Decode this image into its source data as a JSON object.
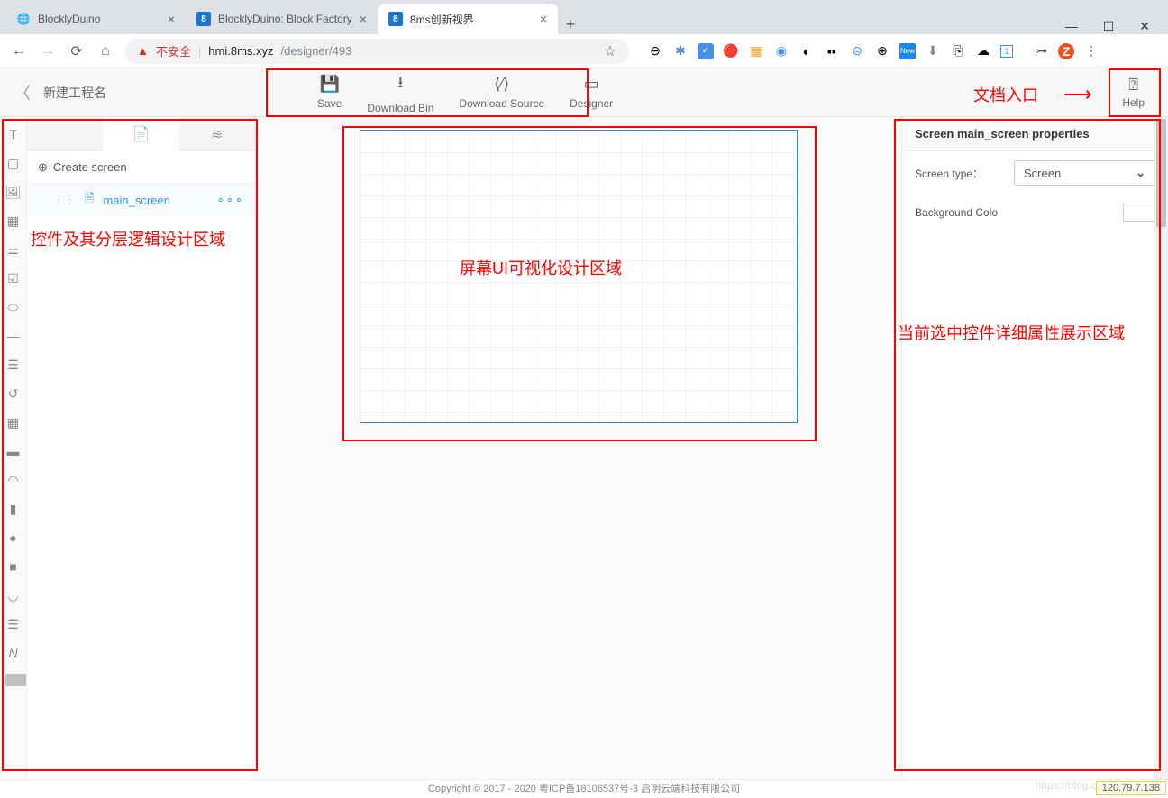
{
  "window": {
    "minimize": "—",
    "maximize": "☐",
    "close": "✕"
  },
  "tabs": [
    {
      "title": "BlocklyDuino",
      "icon": "◌"
    },
    {
      "title": "BlocklyDuino: Block Factory",
      "icon": "8"
    },
    {
      "title": "8ms创新视界",
      "icon": "8",
      "active": true
    }
  ],
  "addressbar": {
    "not_secure": "不安全",
    "host": "hmi.8ms.xyz",
    "path": "/designer/493"
  },
  "header": {
    "project_name": "新建工程名",
    "buttons": {
      "save": "Save",
      "download_bin": "Download Bin",
      "download_source": "Download Source",
      "designer": "Designer"
    },
    "help": "Help"
  },
  "left_panel": {
    "create_screen": "Create screen",
    "screen_item": "main_screen"
  },
  "properties": {
    "title": "Screen main_screen properties",
    "screen_type_label": "Screen type：",
    "screen_type_value": "Screen",
    "bg_color_label": "Background Colo"
  },
  "annotations": {
    "doc_entry": "文档入口",
    "canvas_label": "屏幕UI可视化设计区域",
    "left_label": "控件及其分层逻辑设计区域",
    "right_label": "当前选中控件详细属性展示区域"
  },
  "footer": {
    "copyright": "Copyright © 2017 - 2020 粤ICP备18106537号-3 启明云端科技有限公司",
    "ip": "120.79.7.138",
    "watermark": "https://blog.csdn"
  }
}
